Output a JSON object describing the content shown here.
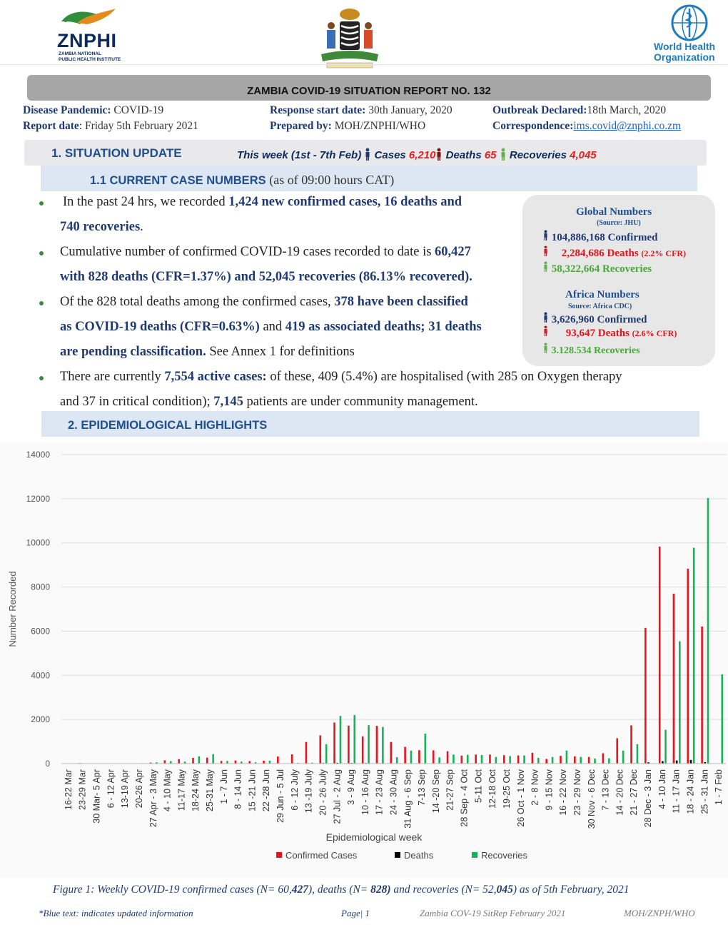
{
  "header": {
    "znphi_name": "ZNPHI",
    "znphi_sub": "ZAMBIA NATIONAL\nPUBLIC HEALTH INSTITUTE",
    "who_name": "World Health\nOrganization",
    "report_title": "ZAMBIA COVID-19 SITUATION REPORT NO. 132"
  },
  "meta": {
    "disease_label": "Disease Pandemic:",
    "disease_value": " COVID-19",
    "response_label": "Response start date:",
    "response_value": " 30th January, 2020",
    "outbreak_label": "Outbreak Declared:",
    "outbreak_value": "18th March, 2020",
    "report_label": "Report date",
    "report_value": ": Friday 5th February 2021",
    "prepared_label": "Prepared by:",
    "prepared_value": " MOH/ZNPHI/WHO",
    "correspondence_label": "Correspondence:",
    "correspondence_value": "ims.covid@znphi.co.zm"
  },
  "situation": {
    "title": "1. SITUATION UPDATE",
    "week_text": "This week (1st - 7th Feb)",
    "cases_label": "Cases",
    "cases_value": "6,210",
    "deaths_label": "Deaths",
    "deaths_value": "65",
    "recoveries_label": "Recoveries",
    "recoveries_value": "4,045"
  },
  "case_numbers": {
    "title": "1.1 CURRENT CASE NUMBERS",
    "subtitle": "(as of 09:00 hours CAT)"
  },
  "bullets": {
    "b1_a": "In the past 24 hrs, we recorded ",
    "b1_b": "1,424 new confirmed cases, 16 deaths and",
    "b1_c": "740 recoveries",
    "b1_d": ".",
    "b2_a": "Cumulative number of confirmed COVID-19 cases recorded to date is ",
    "b2_b": "60,427",
    "b2_c": "with 828 deaths (CFR=1.37%) and 52,045 recoveries (86.13% recovered).",
    "b3_a": "Of the 828 total deaths among the confirmed cases, ",
    "b3_b": "378 have been classified",
    "b3_c": "as COVID-19 deaths (CFR=0.63%)",
    "b3_d": " and ",
    "b3_e": "419 as associated deaths; 31 deaths",
    "b3_f": "are pending classification.",
    "b3_g": " See Annex 1 for definitions",
    "b4_a": "There are currently ",
    "b4_b": "7,554 active cases:",
    "b4_c": " of these, 409 (5.4%) are hospitalised (with 285 on Oxygen therapy",
    "b4_d": "and 37 in critical condition); ",
    "b4_e": "7,145",
    "b4_f": " patients are under community management."
  },
  "global_box": {
    "global_title": "Global Numbers",
    "global_source": "(Source: JHU)",
    "global_confirmed": "104,886,168 Confirmed",
    "global_deaths": "2,284,686 Deaths",
    "global_cfr": "(2.2% CFR)",
    "global_recoveries": "58,322,664 Recoveries",
    "africa_title": "Africa Numbers",
    "africa_source": "Source: Africa CDC)",
    "africa_confirmed": "3,626,960 Confirmed",
    "africa_deaths": "93,647 Deaths",
    "africa_cfr": "(2.6% CFR)",
    "africa_recoveries": "3.128.534 Recoveries"
  },
  "epi": {
    "title": "2.  EPIDEMIOLOGICAL HIGHLIGHTS"
  },
  "colors": {
    "confirmed": "#e8141b",
    "deaths": "#000000",
    "recoveries": "#17b35a"
  },
  "chart_data": {
    "type": "bar",
    "xlabel": "Epidemiological week",
    "ylabel": "Number Recorded",
    "ylim": [
      0,
      14000
    ],
    "yticks": [
      0,
      2000,
      4000,
      6000,
      8000,
      10000,
      12000,
      14000
    ],
    "grid": true,
    "legend_position": "bottom",
    "categories": [
      "16-22 Mar",
      "23-29 Mar",
      "30 Mar- 5 Apr",
      "6 - 12  Apr",
      "13-19 Apr",
      "20-26 Apr",
      "27 Apr - 3 May",
      "4 - 10 May",
      "11-17 May",
      "18-24 May",
      "25-31 May",
      "1 - 7   Jun",
      "8 - 14   Jun",
      "15 -21 Jun",
      "22 -28   Jun",
      "29 Jun - 5 Jul",
      "6  -  12 July",
      "13 -19 July",
      "20  -  26 July",
      "27 Jul - 2 Aug",
      "3 - 9 Aug",
      "10 - 16 Aug",
      "17 - 23 Aug",
      "24 - 30 Aug",
      "31 Aug - 6 Sep",
      "7-13 Sep",
      "14 -20 Sep",
      "21-27 Sep",
      "28 Sep - 4 Oct",
      "5-11 Oct",
      "12-18 Oct",
      "19-25 Oct",
      "26 Oct - 1 Nov",
      "2 - 8 Nov",
      "9 - 15 Nov",
      "16 - 22 Nov",
      "23 - 29 Nov",
      "30 Nov - 6 Dec",
      "7 - 13 Dec",
      "14 - 20 Dec",
      "21 - 27 Dec",
      "28 Dec - 3 Jan",
      "4 - 10 Jan",
      "11 - 17 Jan",
      "18 - 24 Jan",
      "25 - 31 Jan",
      "1 - 7 Feb"
    ],
    "series": [
      {
        "name": "Confirmed Cases",
        "values": [
          3,
          26,
          10,
          15,
          10,
          16,
          44,
          150,
          200,
          260,
          270,
          120,
          140,
          110,
          130,
          320,
          420,
          980,
          1280,
          1860,
          1720,
          1230,
          1710,
          980,
          760,
          610,
          600,
          560,
          360,
          410,
          410,
          380,
          370,
          490,
          210,
          350,
          330,
          300,
          470,
          1150,
          1730,
          6150,
          9830,
          7700,
          8830,
          6210,
          0
        ]
      },
      {
        "name": "Deaths",
        "values": [
          0,
          0,
          0,
          0,
          0,
          0,
          0,
          1,
          2,
          3,
          2,
          3,
          4,
          5,
          6,
          8,
          12,
          18,
          25,
          35,
          30,
          25,
          20,
          15,
          10,
          8,
          6,
          5,
          5,
          4,
          4,
          5,
          4,
          5,
          4,
          4,
          6,
          5,
          6,
          10,
          20,
          60,
          110,
          140,
          165,
          65,
          0
        ]
      },
      {
        "name": "Recoveries",
        "values": [
          0,
          5,
          15,
          10,
          12,
          20,
          60,
          110,
          90,
          330,
          430,
          120,
          90,
          60,
          130,
          10,
          30,
          40,
          880,
          2160,
          2200,
          1740,
          1660,
          290,
          590,
          1360,
          280,
          410,
          400,
          390,
          300,
          340,
          370,
          260,
          300,
          590,
          300,
          230,
          240,
          590,
          880,
          10,
          1530,
          5540,
          9780,
          12030,
          4045
        ]
      }
    ]
  },
  "figure": {
    "caption_a": "Figure 1: Weekly COVID-19 confirmed cases (N= 60,",
    "caption_b": "427",
    "caption_c": "), deaths (N= ",
    "caption_d": "828)",
    "caption_e": " and recoveries (N= 52,",
    "caption_f": "045",
    "caption_g": ") as of 5th February, 2021"
  },
  "footer": {
    "note": "*Blue text: indicates updated  information",
    "page": "Page| 1",
    "sitrep": "Zambia COV-19 SitRep February 2021",
    "org": "MOH/ZNPH/WHO"
  }
}
